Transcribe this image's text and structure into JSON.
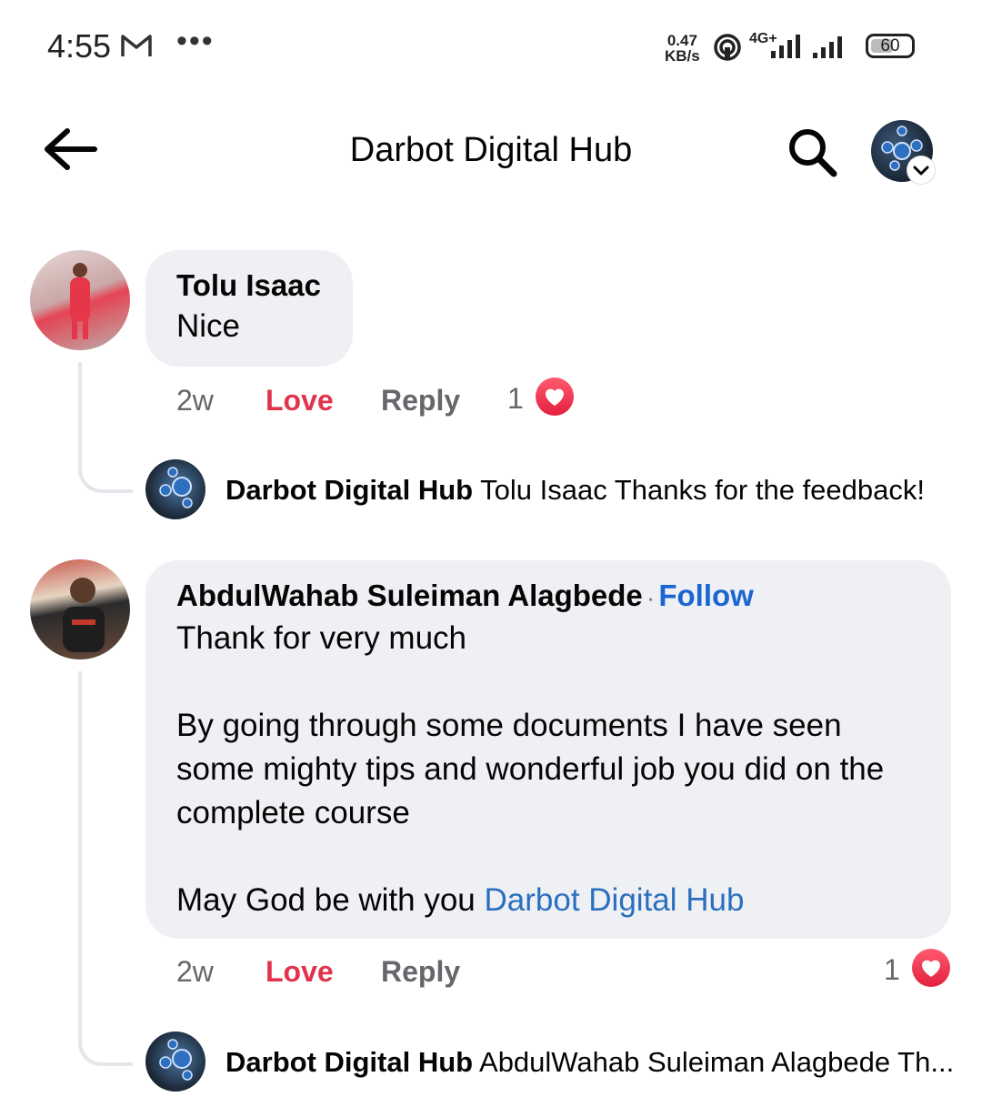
{
  "status_bar": {
    "time": "4:55",
    "speed_value": "0.47",
    "speed_unit": "KB/s",
    "network": "4G+",
    "battery": "60"
  },
  "header": {
    "title": "Darbot Digital Hub"
  },
  "comments": [
    {
      "author": "Tolu Isaac",
      "text": "Nice",
      "age": "2w",
      "love_label": "Love",
      "reply_label": "Reply",
      "reaction_count": "1",
      "reply": {
        "author": "Darbot Digital Hub",
        "text": "Tolu Isaac Thanks for the feedback!"
      }
    },
    {
      "author": "AbdulWahab Suleiman Alagbede",
      "separator": "·",
      "follow_label": "Follow",
      "text": "Thank for very much\n\nBy going through some documents I have seen some mighty tips and wonderful job you did on the complete course\n\nMay God be with you ",
      "mention": "Darbot Digital Hub",
      "age": "2w",
      "love_label": "Love",
      "reply_label": "Reply",
      "reaction_count": "1",
      "reply": {
        "author": "Darbot Digital Hub",
        "text": "AbdulWahab Suleiman Alagbede Th..."
      }
    }
  ],
  "colors": {
    "love": "#e0344c",
    "link": "#1a66d2",
    "bubble": "#eff0f4"
  }
}
